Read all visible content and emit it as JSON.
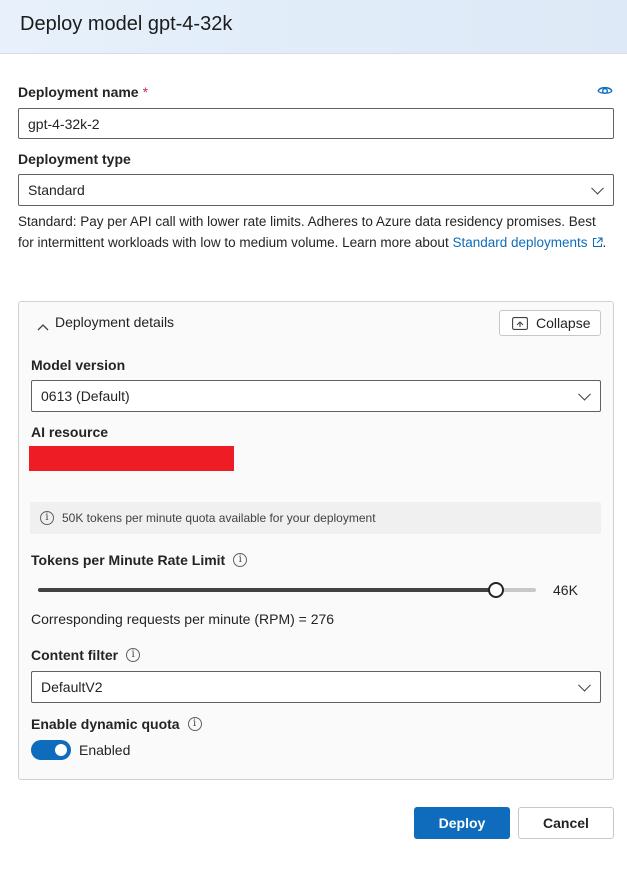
{
  "dialog": {
    "title": "Deploy model gpt-4-32k"
  },
  "deployment_name": {
    "label": "Deployment name",
    "required_marker": "*",
    "value": "gpt-4-32k-2",
    "icon": "eye-icon"
  },
  "deployment_type": {
    "label": "Deployment type",
    "selected": "Standard",
    "description": "Standard: Pay per API call with lower rate limits. Adheres to Azure data residency promises. Best for intermittent workloads with low to medium volume. Learn more about ",
    "link_text": "Standard deployments",
    "link_suffix": "."
  },
  "details": {
    "header": "Deployment details",
    "collapse_label": "Collapse",
    "model_version": {
      "label": "Model version",
      "selected": "0613 (Default)"
    },
    "ai_resource": {
      "label": "AI resource",
      "redacted_color": "#ee1c25"
    },
    "quota_banner": "50K tokens per minute quota available for your deployment",
    "rate_limit": {
      "label": "Tokens per Minute Rate Limit",
      "value_label": "46K",
      "fraction": 0.92,
      "rpm_text": "Corresponding requests per minute (RPM) = 276"
    },
    "content_filter": {
      "label": "Content filter",
      "selected": "DefaultV2"
    },
    "dynamic_quota": {
      "label": "Enable dynamic quota",
      "toggle_state": "Enabled",
      "on": true
    }
  },
  "actions": {
    "deploy_label": "Deploy",
    "cancel_label": "Cancel"
  },
  "colors": {
    "accent": "#0f6cbd",
    "required": "#c4314b"
  }
}
